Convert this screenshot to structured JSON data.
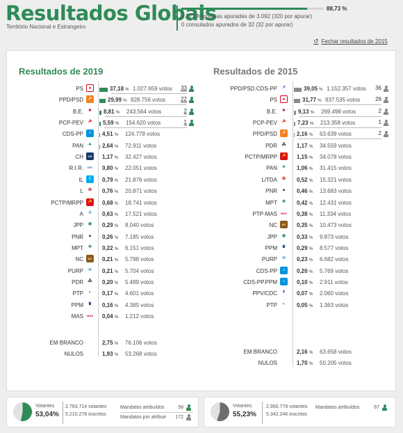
{
  "header": {
    "title": "Resultados Globais",
    "subtitle": "Território Nacional e Estrangeiro",
    "progress_pct": "88,73 %",
    "progress_fraction": 0.8873,
    "parishes": "2.772 freguesias apuradas de 3.092 (320 por apurar)",
    "consulates": "0 consulados apurados de 32 (32 por apurar)",
    "close_label": "Fechar resultados de 2015"
  },
  "colors": {
    "accent": "#2e8b57",
    "gray": "#8a8a8a"
  },
  "y2019": {
    "title": "Resultados de 2019",
    "rows": [
      {
        "party": "PS",
        "logo": "ps",
        "pct": "37,18",
        "votes": "1.027.659 votos",
        "seats": "33",
        "bar": 0.372,
        "seat_line": true
      },
      {
        "party": "PPD/PSD",
        "logo": "psd",
        "pct": "29,99",
        "votes": "828.756 votos",
        "seats": "22",
        "bar": 0.3,
        "seat_line": true
      },
      {
        "party": "B.E.",
        "logo": "be",
        "pct": "8,81",
        "votes": "243.564 votos",
        "seats": "2",
        "bar": 0.088,
        "seat_line": true
      },
      {
        "party": "PCP-PEV",
        "logo": "cdu",
        "pct": "5,59",
        "votes": "154.620 votos",
        "seats": "1",
        "bar": 0.056,
        "seat_line": true
      },
      {
        "party": "CDS-PP",
        "logo": "cds",
        "pct": "4,51",
        "votes": "124.778 votos",
        "seats": "",
        "bar": 0.045,
        "seat_line": false
      },
      {
        "party": "PAN",
        "logo": "pan",
        "pct": "2,64",
        "votes": "72.911 votos",
        "seats": "",
        "bar": 0.026,
        "seat_line": false
      },
      {
        "party": "CH",
        "logo": "ch",
        "pct": "1,17",
        "votes": "32.427 votos",
        "seats": "",
        "bar": 0.012,
        "seat_line": false
      },
      {
        "party": "R.I.R.",
        "logo": "rir",
        "pct": "0,80",
        "votes": "22.051 votos",
        "seats": "",
        "bar": 0.008,
        "seat_line": false
      },
      {
        "party": "IL",
        "logo": "il",
        "pct": "0,79",
        "votes": "21.876 votos",
        "seats": "",
        "bar": 0.008,
        "seat_line": false
      },
      {
        "party": "L",
        "logo": "l",
        "pct": "0,76",
        "votes": "20.871 votos",
        "seats": "",
        "bar": 0.008,
        "seat_line": false
      },
      {
        "party": "PCTP/MRPP",
        "logo": "mrpp",
        "pct": "0,68",
        "votes": "18.741 votos",
        "seats": "",
        "bar": 0.007,
        "seat_line": false
      },
      {
        "party": "A",
        "logo": "a",
        "pct": "0,63",
        "votes": "17.521 votos",
        "seats": "",
        "bar": 0.006,
        "seat_line": false
      },
      {
        "party": "JPP",
        "logo": "jpp",
        "pct": "0,29",
        "votes": "8.040 votos",
        "seats": "",
        "bar": 0.003,
        "seat_line": false
      },
      {
        "party": "PNR",
        "logo": "pnr",
        "pct": "0,26",
        "votes": "7.185 votos",
        "seats": "",
        "bar": 0.003,
        "seat_line": false
      },
      {
        "party": "MPT",
        "logo": "mpt",
        "pct": "0,22",
        "votes": "6.151 votos",
        "seats": "",
        "bar": 0.002,
        "seat_line": false
      },
      {
        "party": "NC",
        "logo": "nc",
        "pct": "0,21",
        "votes": "5.798 votos",
        "seats": "",
        "bar": 0.002,
        "seat_line": false
      },
      {
        "party": "PURP",
        "logo": "purp",
        "pct": "0,21",
        "votes": "5.704 votos",
        "seats": "",
        "bar": 0.002,
        "seat_line": false
      },
      {
        "party": "PDR",
        "logo": "pdr",
        "pct": "0,20",
        "votes": "5.489 votos",
        "seats": "",
        "bar": 0.002,
        "seat_line": false
      },
      {
        "party": "PTP",
        "logo": "ptp",
        "pct": "0,17",
        "votes": "4.601 votos",
        "seats": "",
        "bar": 0.002,
        "seat_line": false
      },
      {
        "party": "PPM",
        "logo": "ppm",
        "pct": "0,16",
        "votes": "4.385 votos",
        "seats": "",
        "bar": 0.002,
        "seat_line": false
      },
      {
        "party": "MAS",
        "logo": "mas",
        "pct": "0,04",
        "votes": "1.212 votos",
        "seats": "",
        "bar": 0.0,
        "seat_line": false
      }
    ],
    "blank": {
      "party": "EM BRANCO",
      "pct": "2,75",
      "votes": "76.106 votos"
    },
    "null": {
      "party": "NULOS",
      "pct": "1,93",
      "votes": "53.268 votos"
    }
  },
  "y2015": {
    "title": "Resultados de 2015",
    "rows": [
      {
        "party": "PPD/PSD.CDS-PP",
        "logo": "paf",
        "pct": "39,05",
        "votes": "1.152.357 votos",
        "seats": "36",
        "bar": 0.391,
        "seat_line": false
      },
      {
        "party": "PS",
        "logo": "ps",
        "pct": "31,77",
        "votes": "937.535 votos",
        "seats": "26",
        "bar": 0.318,
        "seat_line": true
      },
      {
        "party": "B.E.",
        "logo": "be",
        "pct": "9,13",
        "votes": "269.498 votos",
        "seats": "2",
        "bar": 0.091,
        "seat_line": true
      },
      {
        "party": "PCP-PEV",
        "logo": "cdu",
        "pct": "7,23",
        "votes": "213.358 votos",
        "seats": "1",
        "bar": 0.072,
        "seat_line": true
      },
      {
        "party": "PPD/PSD",
        "logo": "psd",
        "pct": "2,16",
        "votes": "63.639 votos",
        "seats": "2",
        "bar": 0.022,
        "seat_line": true
      },
      {
        "party": "PDR",
        "logo": "pdr",
        "pct": "1,17",
        "votes": "34.559 votos",
        "seats": "",
        "bar": 0.012,
        "seat_line": false
      },
      {
        "party": "PCTP/MRPP",
        "logo": "mrpp",
        "pct": "1,15",
        "votes": "34.078 votos",
        "seats": "",
        "bar": 0.011,
        "seat_line": false
      },
      {
        "party": "PAN",
        "logo": "pan",
        "pct": "1,06",
        "votes": "31.415 votos",
        "seats": "",
        "bar": 0.011,
        "seat_line": false
      },
      {
        "party": "L/TDA",
        "logo": "l",
        "pct": "0,52",
        "votes": "15.321 votos",
        "seats": "",
        "bar": 0.005,
        "seat_line": false
      },
      {
        "party": "PNR",
        "logo": "pnr",
        "pct": "0,46",
        "votes": "13.683 votos",
        "seats": "",
        "bar": 0.005,
        "seat_line": false
      },
      {
        "party": "MPT",
        "logo": "mpt",
        "pct": "0,42",
        "votes": "12.431 votos",
        "seats": "",
        "bar": 0.004,
        "seat_line": false
      },
      {
        "party": "PTP-MAS",
        "logo": "mas",
        "pct": "0,38",
        "votes": "11.334 votos",
        "seats": "",
        "bar": 0.004,
        "seat_line": false
      },
      {
        "party": "NC",
        "logo": "nc",
        "pct": "0,35",
        "votes": "10.473 votos",
        "seats": "",
        "bar": 0.004,
        "seat_line": false
      },
      {
        "party": "JPP",
        "logo": "jpp",
        "pct": "0,33",
        "votes": "9.873 votos",
        "seats": "",
        "bar": 0.003,
        "seat_line": false
      },
      {
        "party": "PPM",
        "logo": "ppm",
        "pct": "0,29",
        "votes": "8.577 votos",
        "seats": "",
        "bar": 0.003,
        "seat_line": false
      },
      {
        "party": "PURP",
        "logo": "purp",
        "pct": "0,23",
        "votes": "6.682 votos",
        "seats": "",
        "bar": 0.002,
        "seat_line": false
      },
      {
        "party": "CDS-PP",
        "logo": "cds",
        "pct": "0,20",
        "votes": "5.769 votos",
        "seats": "",
        "bar": 0.002,
        "seat_line": false
      },
      {
        "party": "CDS-PP.PPM",
        "logo": "cds",
        "pct": "0,10",
        "votes": "2.911 votos",
        "seats": "",
        "bar": 0.001,
        "seat_line": false
      },
      {
        "party": "PPV/CDC",
        "logo": "ppv",
        "pct": "0,07",
        "votes": "2.060 votos",
        "seats": "",
        "bar": 0.001,
        "seat_line": false
      },
      {
        "party": "PTP",
        "logo": "ptp",
        "pct": "0,05",
        "votes": "1.363 votos",
        "seats": "",
        "bar": 0.0,
        "seat_line": false
      }
    ],
    "blank": {
      "party": "EM BRANCO",
      "pct": "2,16",
      "votes": "63.658 votos"
    },
    "null": {
      "party": "NULOS",
      "pct": "1,70",
      "votes": "50.205 votos"
    }
  },
  "footer2019": {
    "voters_label": "Votantes",
    "voters_pct": "53,04%",
    "turnout_fraction": 0.5304,
    "voters_count": "2.763.714 votantes",
    "registered": "5.210.276 inscritos",
    "mandates_assigned_label": "Mandatos atribuídos",
    "mandates_assigned": "58",
    "mandates_pending_label": "Mandatos por atribuir",
    "mandates_pending": "172"
  },
  "footer2015": {
    "voters_label": "Votantes",
    "voters_pct": "55,23%",
    "turnout_fraction": 0.5523,
    "voters_count": "2.950.779 votantes",
    "registered": "5.342.246 inscritos",
    "mandates_assigned_label": "Mandatos atribuídos",
    "mandates_assigned": "67"
  }
}
